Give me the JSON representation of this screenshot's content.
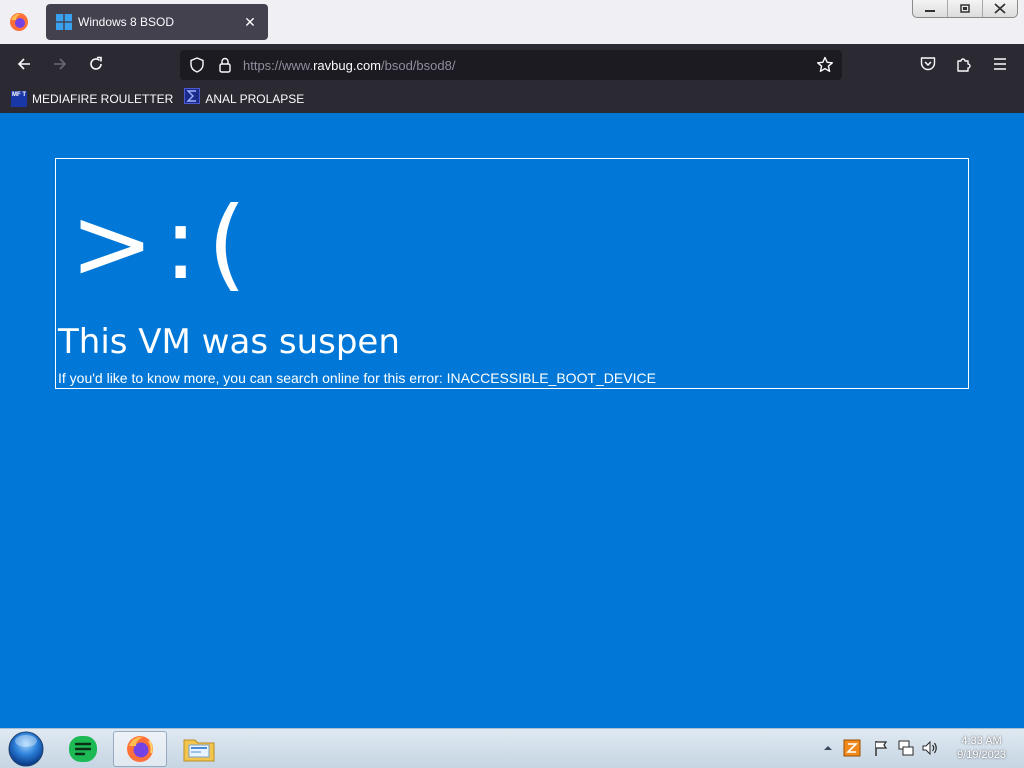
{
  "browser": {
    "tab": {
      "title": "Windows 8 BSOD",
      "close_glyph": "✕"
    },
    "url": {
      "prefix": "https://www.",
      "host": "ravbug.com",
      "path": "/bsod/bsod8/"
    },
    "bookmarks": [
      {
        "label": "MEDIAFIRE ROULETTER",
        "icon": "mft-icon",
        "icon_text": "MF T"
      },
      {
        "label": "ANAL PROLAPSE",
        "icon": "sigma-icon"
      }
    ]
  },
  "bsod": {
    "face": ">:(",
    "title": "This VM was suspen",
    "subtitle": "If you'd like to know more, you can search online for this error: INACCESSIBLE_BOOT_DEVICE",
    "background_color": "#0178d7"
  },
  "taskbar": {
    "apps": [
      "start-orb",
      "notes-app-icon",
      "firefox-icon",
      "file-explorer-icon"
    ],
    "clock": {
      "time": "4:33 AM",
      "date": "9/19/2023"
    }
  }
}
